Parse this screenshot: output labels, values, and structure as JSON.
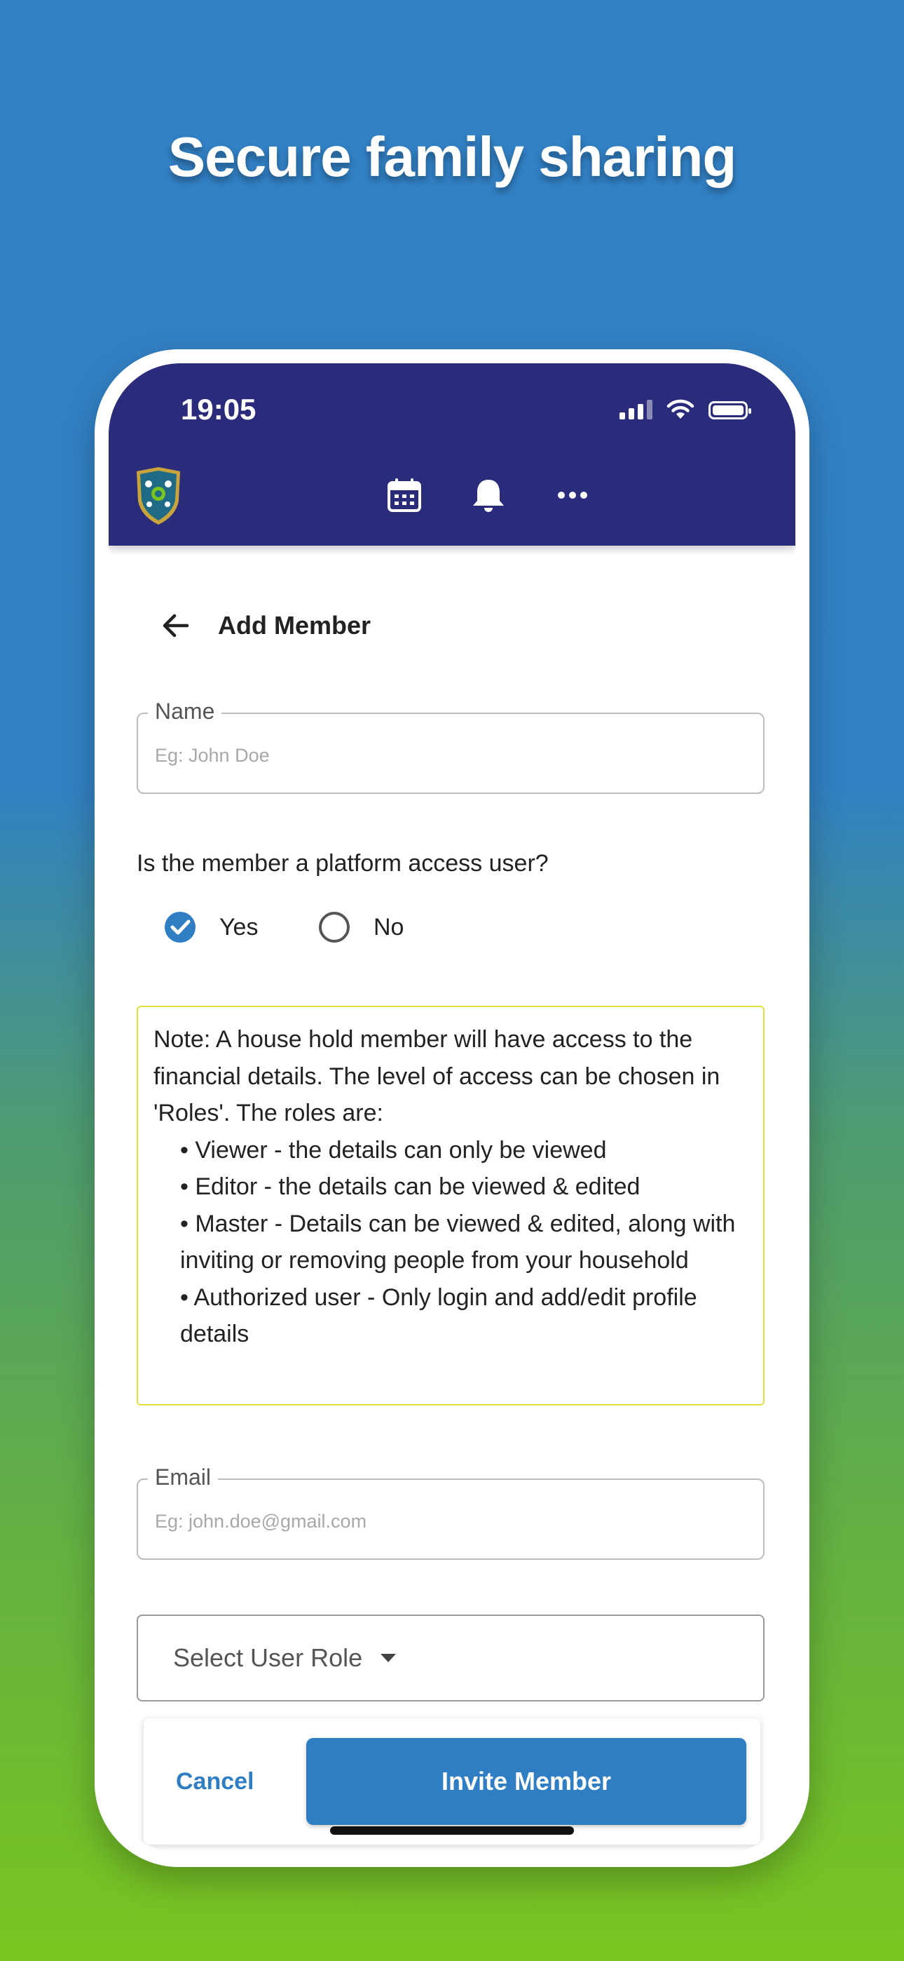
{
  "headline": "Secure family sharing",
  "status_bar": {
    "time": "19:05"
  },
  "app_bar": {
    "icons": [
      "app-logo",
      "calendar-icon",
      "bell-icon",
      "more-icon"
    ],
    "color": "#2b2b7c"
  },
  "page": {
    "title": "Add Member"
  },
  "name_field": {
    "label": "Name",
    "placeholder": "Eg: John Doe",
    "value": ""
  },
  "platform_question": {
    "text": "Is the member a platform access user?",
    "options": [
      {
        "label": "Yes",
        "selected": true
      },
      {
        "label": "No",
        "selected": false
      }
    ]
  },
  "note": {
    "intro": "Note: A house hold member will have access to the financial details. The level of access can be chosen in 'Roles'. The roles are:",
    "bullets": [
      "• Viewer - the details can only be viewed",
      "• Editor - the details can be viewed & edited",
      "• Master - Details can be viewed & edited, along with inviting or removing people from your household",
      "• Authorized user - Only login and add/edit profile details"
    ]
  },
  "email_field": {
    "label": "Email",
    "placeholder": "Eg: john.doe@gmail.com",
    "value": ""
  },
  "role_select": {
    "placeholder": "Select User Role"
  },
  "actions": {
    "cancel": "Cancel",
    "invite": "Invite Member"
  },
  "colors": {
    "primary": "#2f7ec4",
    "note_border": "#dfe23c",
    "appbar": "#2b2b7c"
  }
}
